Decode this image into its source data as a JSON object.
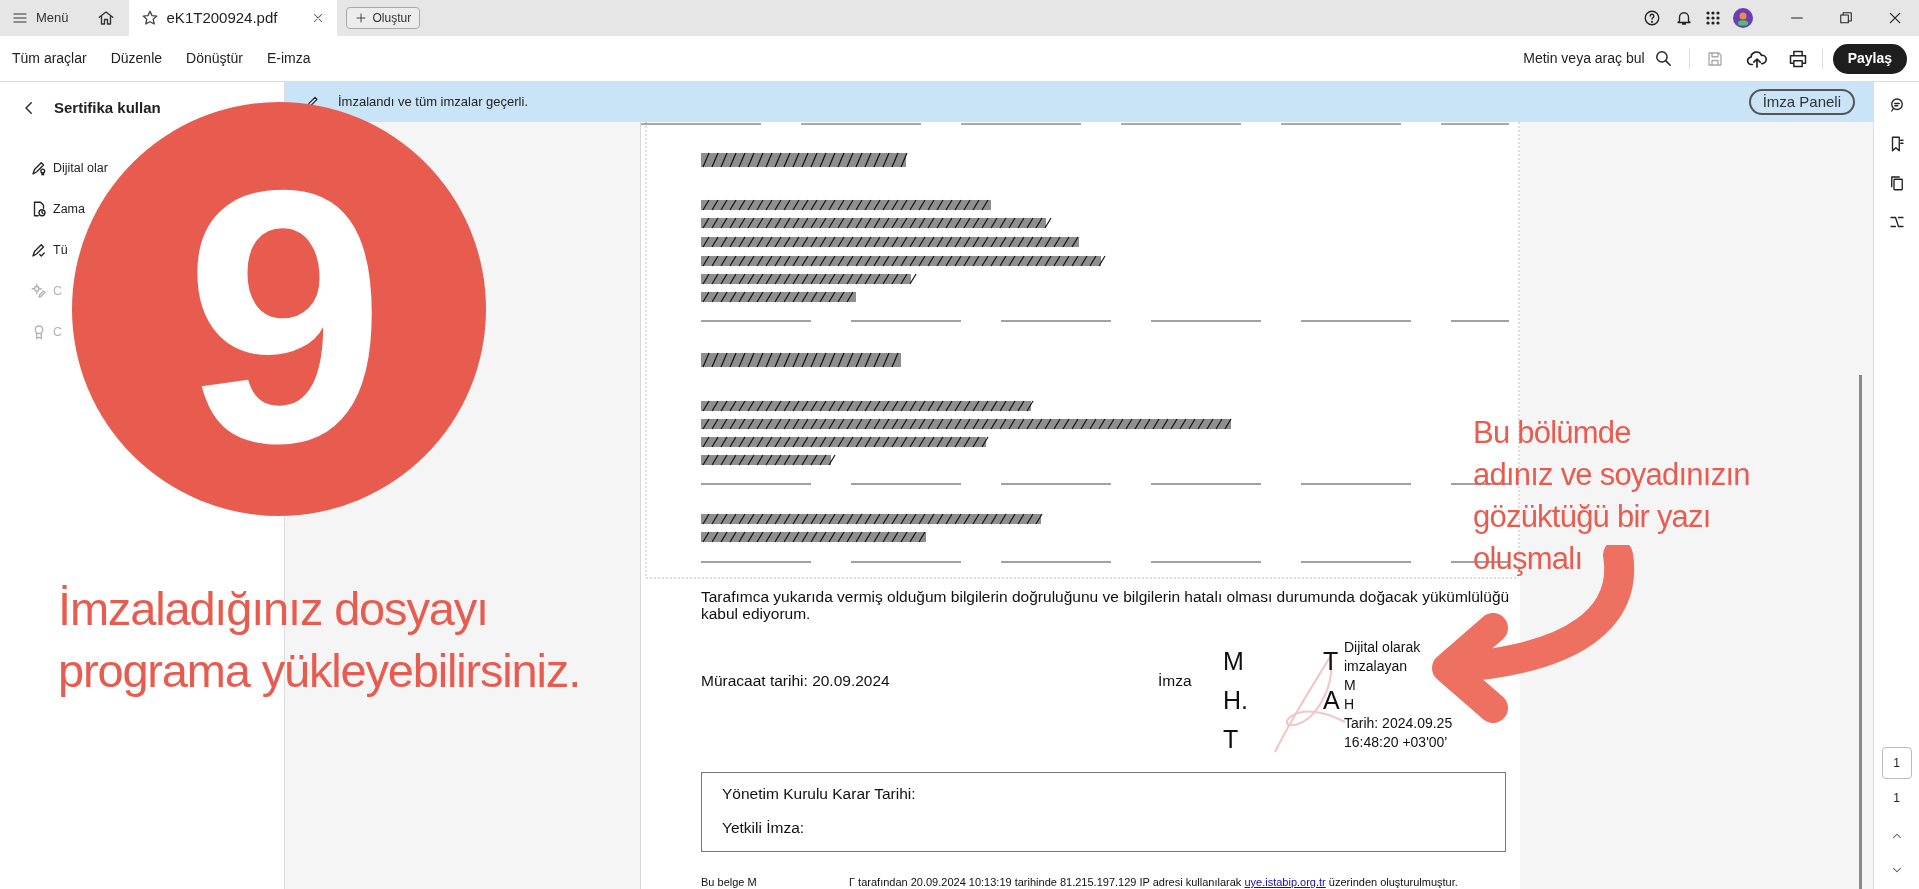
{
  "title_bar": {
    "menu_label": "Menü",
    "tabs": [
      {
        "label": "eK1T200924.pdf",
        "selected": true
      }
    ],
    "create_button": "Oluştur"
  },
  "toolbar": {
    "items": [
      "Tüm araçlar",
      "Düzenle",
      "Dönüştür",
      "E-imza"
    ],
    "search_label": "Metin veya araç bul",
    "share_button": "Paylaş"
  },
  "left_panel": {
    "title": "Sertifika kullan",
    "items": [
      {
        "label": "Dijital olar",
        "disabled": false
      },
      {
        "label": "Zama",
        "disabled": false
      },
      {
        "label": "Tü",
        "disabled": false
      },
      {
        "label": "C",
        "disabled": true
      },
      {
        "label": "C",
        "disabled": true
      }
    ]
  },
  "notification": {
    "message": "İmzalandı ve tüm imzalar geçerli.",
    "button": "İmza Paneli"
  },
  "document": {
    "declaration": "Tarafımca yukarıda vermiş olduğum bilgilerin doğruluğunu ve bilgilerin hatalı olması durumunda doğacak yükümlülüğü kabul ediyorum.",
    "application_date": "Müracaat tarihi: 20.09.2024",
    "signature_label": "İmza",
    "signature_letters": [
      "M",
      "T",
      "H.",
      "A",
      "T"
    ],
    "signature_details": [
      "Dijital olarak",
      "imzalayan",
      "M",
      "H",
      "Tarih: 2024.09.25",
      "16:48:20 +03'00'"
    ],
    "board_box": [
      "Yönetim Kurulu Karar Tarihi:",
      "Yetkili İmza:"
    ],
    "footer": {
      "prefix": "Bu belge M",
      "before_link": "Γ tarafından 20.09.2024 10:13:19 tarihinde 81.215.197.129 IP adresi kullanılarak",
      "link": "uye.istabip.org.tr",
      "after_link": "üzerinden oluşturulmuştur."
    }
  },
  "page_nav": {
    "current_page": "1",
    "total_pages": "1"
  },
  "overlay": {
    "step_number": "9",
    "instruction_lines": [
      "İmzaladığınız dosyayı",
      "programa yükleyebilirsiniz."
    ],
    "callout_lines": [
      "Bu bölümde",
      "adınız ve soyadınızın",
      "gözüktüğü bir yazı",
      "oluşmalı"
    ]
  }
}
